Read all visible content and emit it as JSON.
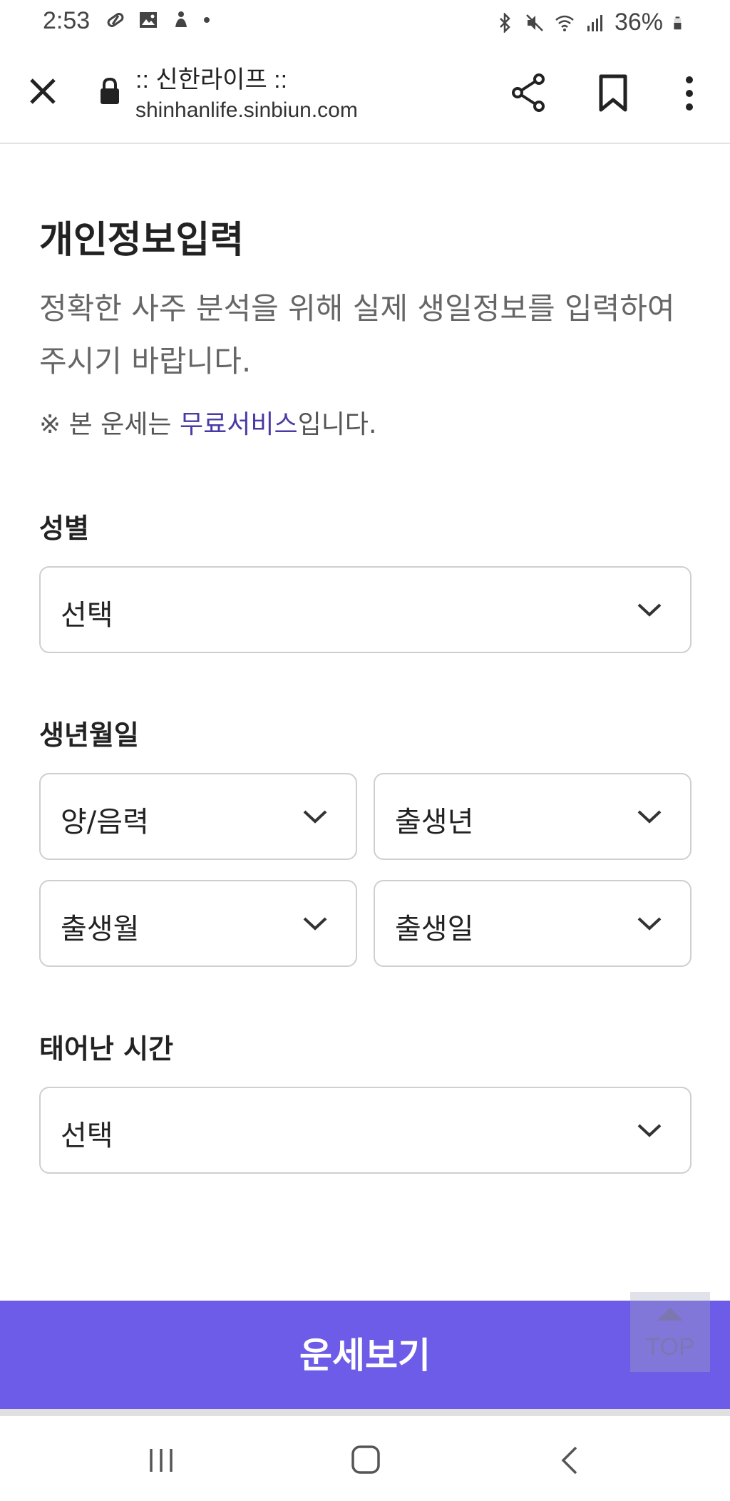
{
  "status_bar": {
    "time": "2:53",
    "battery": "36%"
  },
  "browser": {
    "title": ":: 신한라이프 ::",
    "url": "shinhanlife.sinbiun.com"
  },
  "page": {
    "title": "개인정보입력",
    "description": "정확한 사주 분석을 위해 실제 생일정보를 입력하여 주시기 바랍니다.",
    "notice_prefix": "※ 본 운세는 ",
    "notice_highlight": "무료서비스",
    "notice_suffix": "입니다.",
    "highlight_color": "#4a3aa6"
  },
  "form": {
    "gender": {
      "label": "성별",
      "value": "선택"
    },
    "birth": {
      "label": "생년월일",
      "calendar": "양/음력",
      "year": "출생년",
      "month": "출생월",
      "day": "출생일"
    },
    "time": {
      "label": "태어난 시간",
      "value": "선택"
    }
  },
  "cta": {
    "label": "운세보기",
    "color": "#6c5ce7"
  },
  "top_button": {
    "label": "TOP"
  }
}
